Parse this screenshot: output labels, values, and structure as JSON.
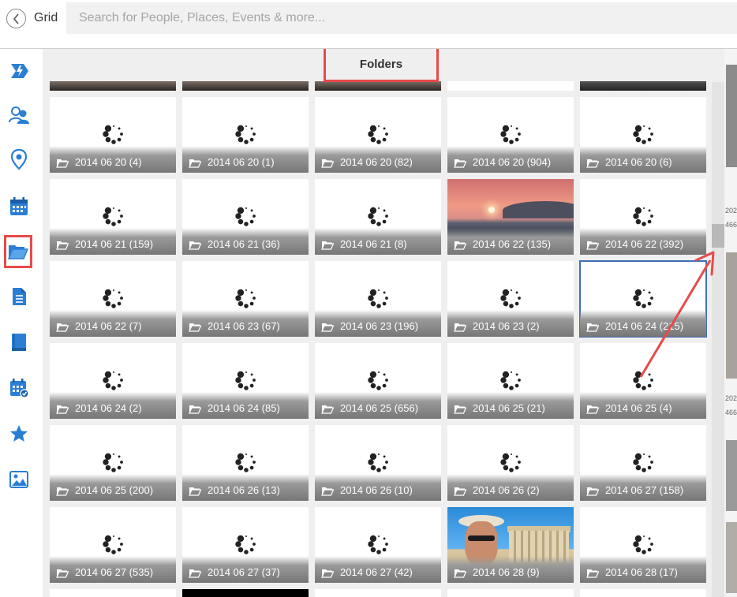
{
  "topbar": {
    "view_label": "Grid",
    "search_placeholder": "Search for People, Places, Events & more..."
  },
  "sidebar": {
    "items": [
      {
        "icon": "quick-flash-icon"
      },
      {
        "icon": "people-icon"
      },
      {
        "icon": "places-icon"
      },
      {
        "icon": "calendar-icon"
      },
      {
        "icon": "folder-icon",
        "active": true
      },
      {
        "icon": "document-icon"
      },
      {
        "icon": "book-icon"
      },
      {
        "icon": "event-icon"
      },
      {
        "icon": "star-icon"
      },
      {
        "icon": "picture-icon"
      }
    ]
  },
  "main": {
    "title": "Folders",
    "tiles": [
      {
        "label": "2014 06 20 (4)",
        "type": "loading"
      },
      {
        "label": "2014 06 20 (1)",
        "type": "loading"
      },
      {
        "label": "2014 06 20 (82)",
        "type": "loading"
      },
      {
        "label": "2014 06 20 (904)",
        "type": "loading"
      },
      {
        "label": "2014 06 20 (6)",
        "type": "loading"
      },
      {
        "label": "2014 06 21 (159)",
        "type": "loading"
      },
      {
        "label": "2014 06 21 (36)",
        "type": "loading"
      },
      {
        "label": "2014 06 21 (8)",
        "type": "loading"
      },
      {
        "label": "2014 06 22 (135)",
        "type": "sunset"
      },
      {
        "label": "2014 06 22 (392)",
        "type": "loading"
      },
      {
        "label": "2014 06 22 (7)",
        "type": "loading"
      },
      {
        "label": "2014 06 23 (67)",
        "type": "loading"
      },
      {
        "label": "2014 06 23 (196)",
        "type": "loading"
      },
      {
        "label": "2014 06 23 (2)",
        "type": "loading"
      },
      {
        "label": "2014 06 24 (215)",
        "type": "loading",
        "selected": true
      },
      {
        "label": "2014 06 24 (2)",
        "type": "loading"
      },
      {
        "label": "2014 06 24 (85)",
        "type": "loading"
      },
      {
        "label": "2014 06 25 (656)",
        "type": "loading"
      },
      {
        "label": "2014 06 25 (21)",
        "type": "loading"
      },
      {
        "label": "2014 06 25 (4)",
        "type": "loading"
      },
      {
        "label": "2014 06 25 (200)",
        "type": "loading"
      },
      {
        "label": "2014 06 26 (13)",
        "type": "loading"
      },
      {
        "label": "2014 06 26 (10)",
        "type": "loading"
      },
      {
        "label": "2014 06 26 (2)",
        "type": "loading"
      },
      {
        "label": "2014 06 27 (158)",
        "type": "loading"
      },
      {
        "label": "2014 06 27 (535)",
        "type": "loading"
      },
      {
        "label": "2014 06 27 (37)",
        "type": "loading"
      },
      {
        "label": "2014 06 27 (42)",
        "type": "loading"
      },
      {
        "label": "2014 06 28 (9)",
        "type": "person"
      },
      {
        "label": "2014 06 28 (17)",
        "type": "loading"
      }
    ]
  },
  "right_strip": {
    "texts": [
      "202",
      "466",
      "202",
      "466"
    ]
  },
  "colors": {
    "annotation": "#e84a4a",
    "selection": "#3f6fb7",
    "icon_blue": "#2a7fd4"
  }
}
